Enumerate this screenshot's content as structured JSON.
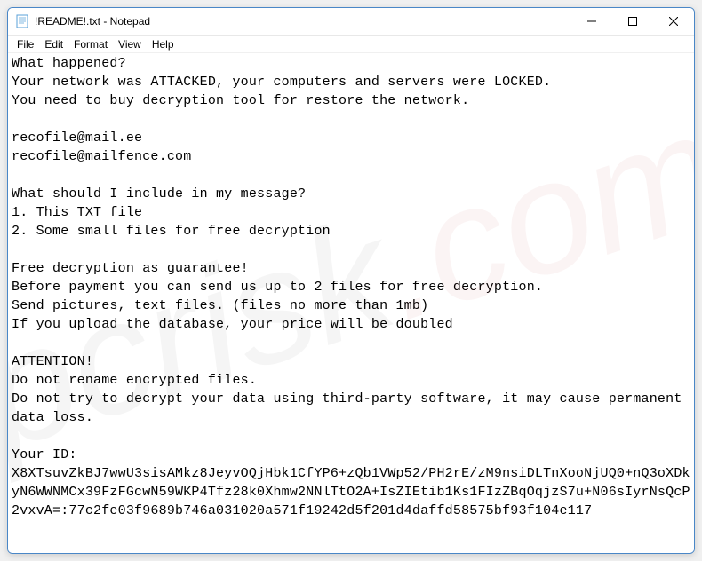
{
  "window": {
    "title": "!README!.txt - Notepad"
  },
  "menu": {
    "file": "File",
    "edit": "Edit",
    "format": "Format",
    "view": "View",
    "help": "Help"
  },
  "content": {
    "text": "What happened?\nYour network was ATTACKED, your computers and servers were LOCKED.\nYou need to buy decryption tool for restore the network.\n\nrecofile@mail.ee\nrecofile@mailfence.com\n\nWhat should I include in my message?\n1. This TXT file\n2. Some small files for free decryption\n\nFree decryption as guarantee!\nBefore payment you can send us up to 2 files for free decryption.\nSend pictures, text files. (files no more than 1mb)\nIf you upload the database, your price will be doubled\n\nATTENTION!\nDo not rename encrypted files.\nDo not try to decrypt your data using third-party software, it may cause permanent data loss.\n\nYour ID:\nX8XTsuvZkBJ7wwU3sisAMkz8JeyvOQjHbk1CfYP6+zQb1VWp52/PH2rE/zM9nsiDLTnXooNjUQ0+nQ3oXDkyN6WWNMCx39FzFGcwN59WKP4Tfz28k0Xhmw2NNlTtO2A+IsZIEtib1Ks1FIzZBqOqjzS7u+N06sIyrNsQcP2vxvA=:77c2fe03f9689b746a031020a571f19242d5f201d4daffd58575bf93f104e117"
  },
  "watermark": {
    "brand": "pcrisk",
    "tld": ".com"
  }
}
